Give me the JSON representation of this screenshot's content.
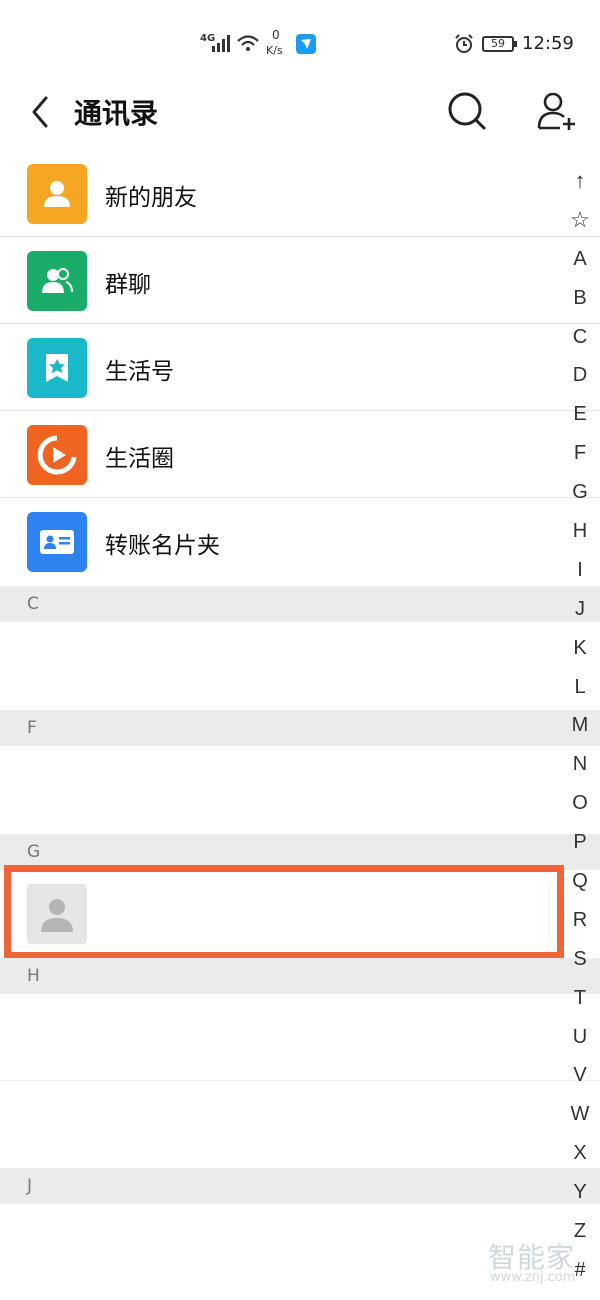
{
  "status_bar": {
    "network": "4G",
    "speed_value": "0",
    "speed_unit": "K/s",
    "battery": "59",
    "time": "12:59"
  },
  "header": {
    "title": "通讯录",
    "back_icon": "chevron-left-icon",
    "search_icon": "search-icon",
    "add_icon": "add-contact-icon"
  },
  "functions": [
    {
      "label": "新的朋友",
      "icon": "person-icon",
      "color": "#f5a623"
    },
    {
      "label": "群聊",
      "icon": "group-icon",
      "color": "#1aad6a"
    },
    {
      "label": "生活号",
      "icon": "bookmark-star-icon",
      "color": "#19b9c9"
    },
    {
      "label": "生活圈",
      "icon": "play-circle-icon",
      "color": "#f06421"
    },
    {
      "label": "转账名片夹",
      "icon": "id-card-icon",
      "color": "#2e82f2"
    }
  ],
  "sections": [
    "C",
    "F",
    "G",
    "H",
    "J"
  ],
  "index": [
    "↑",
    "☆",
    "A",
    "B",
    "C",
    "D",
    "E",
    "F",
    "G",
    "H",
    "I",
    "J",
    "K",
    "L",
    "M",
    "N",
    "O",
    "P",
    "Q",
    "R",
    "S",
    "T",
    "U",
    "V",
    "W",
    "X",
    "Y",
    "Z",
    "#"
  ],
  "watermark": {
    "brand": "智能家",
    "url": "www.znj.com"
  },
  "colors": {
    "highlight": "#f0643c",
    "section_bg": "#ebebeb"
  }
}
